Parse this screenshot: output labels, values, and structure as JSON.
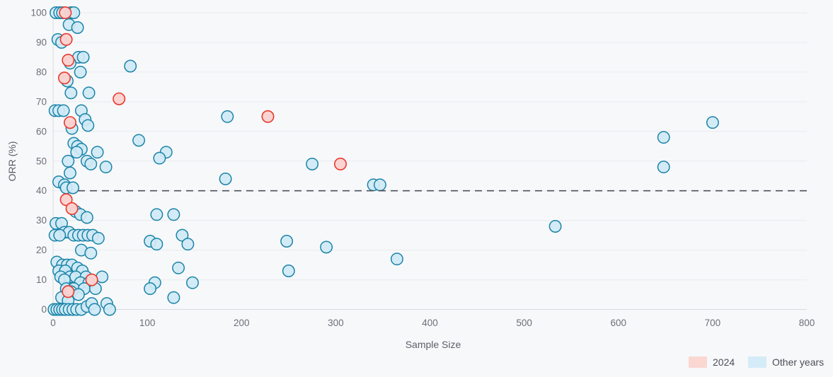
{
  "chart_data": {
    "type": "scatter",
    "title": "",
    "xlabel": "Sample Size",
    "ylabel": "ORR (%)",
    "xlim": [
      0,
      800
    ],
    "ylim": [
      0,
      100
    ],
    "xticks": [
      0,
      100,
      200,
      300,
      400,
      500,
      600,
      700,
      800
    ],
    "yticks": [
      0,
      10,
      20,
      30,
      40,
      50,
      60,
      70,
      80,
      90,
      100
    ],
    "grid": true,
    "legend_position": "bottom-right",
    "annotations": [
      {
        "type": "hline",
        "y": 40,
        "style": "dashed",
        "color": "#4b4f58",
        "label": ""
      }
    ],
    "series": [
      {
        "name": "2024",
        "color": "#e8392f",
        "fill": "#fbd2cf",
        "points": [
          {
            "x": 13,
            "y": 100
          },
          {
            "x": 14,
            "y": 91
          },
          {
            "x": 16,
            "y": 84
          },
          {
            "x": 12,
            "y": 78
          },
          {
            "x": 18,
            "y": 63
          },
          {
            "x": 70,
            "y": 71
          },
          {
            "x": 228,
            "y": 65
          },
          {
            "x": 305,
            "y": 49
          },
          {
            "x": 14,
            "y": 37
          },
          {
            "x": 20,
            "y": 34
          },
          {
            "x": 41,
            "y": 10
          },
          {
            "x": 16,
            "y": 6
          }
        ]
      },
      {
        "name": "Other years",
        "color": "#1a84a8",
        "fill": "#cfe9f5",
        "points": [
          {
            "x": 3,
            "y": 100
          },
          {
            "x": 7,
            "y": 100
          },
          {
            "x": 10,
            "y": 100
          },
          {
            "x": 19,
            "y": 100
          },
          {
            "x": 22,
            "y": 100
          },
          {
            "x": 17,
            "y": 96
          },
          {
            "x": 26,
            "y": 95
          },
          {
            "x": 5,
            "y": 91
          },
          {
            "x": 9,
            "y": 90
          },
          {
            "x": 27,
            "y": 85
          },
          {
            "x": 32,
            "y": 85
          },
          {
            "x": 18,
            "y": 83
          },
          {
            "x": 82,
            "y": 82
          },
          {
            "x": 29,
            "y": 80
          },
          {
            "x": 15,
            "y": 77
          },
          {
            "x": 19,
            "y": 73
          },
          {
            "x": 38,
            "y": 73
          },
          {
            "x": 2,
            "y": 67
          },
          {
            "x": 6,
            "y": 67
          },
          {
            "x": 11,
            "y": 67
          },
          {
            "x": 30,
            "y": 67
          },
          {
            "x": 185,
            "y": 65
          },
          {
            "x": 34,
            "y": 64
          },
          {
            "x": 20,
            "y": 61
          },
          {
            "x": 37,
            "y": 62
          },
          {
            "x": 91,
            "y": 57
          },
          {
            "x": 648,
            "y": 58
          },
          {
            "x": 700,
            "y": 63
          },
          {
            "x": 22,
            "y": 56
          },
          {
            "x": 26,
            "y": 55
          },
          {
            "x": 30,
            "y": 54
          },
          {
            "x": 25,
            "y": 53
          },
          {
            "x": 47,
            "y": 53
          },
          {
            "x": 120,
            "y": 53
          },
          {
            "x": 113,
            "y": 51
          },
          {
            "x": 16,
            "y": 50
          },
          {
            "x": 36,
            "y": 50
          },
          {
            "x": 40,
            "y": 49
          },
          {
            "x": 56,
            "y": 48
          },
          {
            "x": 275,
            "y": 49
          },
          {
            "x": 648,
            "y": 48
          },
          {
            "x": 18,
            "y": 46
          },
          {
            "x": 183,
            "y": 44
          },
          {
            "x": 6,
            "y": 43
          },
          {
            "x": 12,
            "y": 42
          },
          {
            "x": 340,
            "y": 42
          },
          {
            "x": 347,
            "y": 42
          },
          {
            "x": 14,
            "y": 41
          },
          {
            "x": 21,
            "y": 41
          },
          {
            "x": 24,
            "y": 33
          },
          {
            "x": 29,
            "y": 32
          },
          {
            "x": 110,
            "y": 32
          },
          {
            "x": 128,
            "y": 32
          },
          {
            "x": 36,
            "y": 31
          },
          {
            "x": 3,
            "y": 29
          },
          {
            "x": 9,
            "y": 29
          },
          {
            "x": 533,
            "y": 28
          },
          {
            "x": 12,
            "y": 26
          },
          {
            "x": 17,
            "y": 26
          },
          {
            "x": 2,
            "y": 25
          },
          {
            "x": 7,
            "y": 25
          },
          {
            "x": 22,
            "y": 25
          },
          {
            "x": 27,
            "y": 25
          },
          {
            "x": 32,
            "y": 25
          },
          {
            "x": 37,
            "y": 25
          },
          {
            "x": 42,
            "y": 25
          },
          {
            "x": 48,
            "y": 24
          },
          {
            "x": 103,
            "y": 23
          },
          {
            "x": 110,
            "y": 22
          },
          {
            "x": 137,
            "y": 25
          },
          {
            "x": 143,
            "y": 22
          },
          {
            "x": 248,
            "y": 23
          },
          {
            "x": 290,
            "y": 21
          },
          {
            "x": 30,
            "y": 20
          },
          {
            "x": 40,
            "y": 19
          },
          {
            "x": 365,
            "y": 17
          },
          {
            "x": 4,
            "y": 16
          },
          {
            "x": 10,
            "y": 15
          },
          {
            "x": 15,
            "y": 15
          },
          {
            "x": 20,
            "y": 15
          },
          {
            "x": 26,
            "y": 14
          },
          {
            "x": 6,
            "y": 13
          },
          {
            "x": 13,
            "y": 13
          },
          {
            "x": 31,
            "y": 13
          },
          {
            "x": 133,
            "y": 14
          },
          {
            "x": 250,
            "y": 13
          },
          {
            "x": 8,
            "y": 11
          },
          {
            "x": 18,
            "y": 11
          },
          {
            "x": 24,
            "y": 11
          },
          {
            "x": 35,
            "y": 11
          },
          {
            "x": 52,
            "y": 11
          },
          {
            "x": 12,
            "y": 10
          },
          {
            "x": 29,
            "y": 9
          },
          {
            "x": 38,
            "y": 9
          },
          {
            "x": 108,
            "y": 9
          },
          {
            "x": 148,
            "y": 9
          },
          {
            "x": 14,
            "y": 7
          },
          {
            "x": 22,
            "y": 7
          },
          {
            "x": 33,
            "y": 7
          },
          {
            "x": 45,
            "y": 7
          },
          {
            "x": 103,
            "y": 7
          },
          {
            "x": 19,
            "y": 6
          },
          {
            "x": 27,
            "y": 5
          },
          {
            "x": 9,
            "y": 4
          },
          {
            "x": 16,
            "y": 3
          },
          {
            "x": 128,
            "y": 4
          },
          {
            "x": 1,
            "y": 0
          },
          {
            "x": 4,
            "y": 0
          },
          {
            "x": 7,
            "y": 0
          },
          {
            "x": 10,
            "y": 0
          },
          {
            "x": 13,
            "y": 0
          },
          {
            "x": 17,
            "y": 0
          },
          {
            "x": 21,
            "y": 0
          },
          {
            "x": 25,
            "y": 0
          },
          {
            "x": 30,
            "y": 0
          },
          {
            "x": 36,
            "y": 1
          },
          {
            "x": 41,
            "y": 2
          },
          {
            "x": 44,
            "y": 0
          },
          {
            "x": 57,
            "y": 2
          },
          {
            "x": 60,
            "y": 0
          }
        ]
      }
    ]
  },
  "axes": {
    "x": {
      "title": "Sample Size",
      "tick_labels": [
        "0",
        "100",
        "200",
        "300",
        "400",
        "500",
        "600",
        "700",
        "800"
      ]
    },
    "y": {
      "title": "ORR (%)",
      "tick_labels": [
        "0",
        "10",
        "20",
        "30",
        "40",
        "50",
        "60",
        "70",
        "80",
        "90",
        "100"
      ]
    }
  },
  "legend": {
    "items": [
      {
        "label": "2024",
        "color": "#fbd7d2"
      },
      {
        "label": "Other years",
        "color": "#d4ecf7"
      }
    ]
  },
  "colors": {
    "background": "#f7f8fa",
    "grid": "#e9ebef",
    "accent_2024": "#e8392f",
    "accent_other": "#1a84a8",
    "threshold": "#4b4f58"
  }
}
